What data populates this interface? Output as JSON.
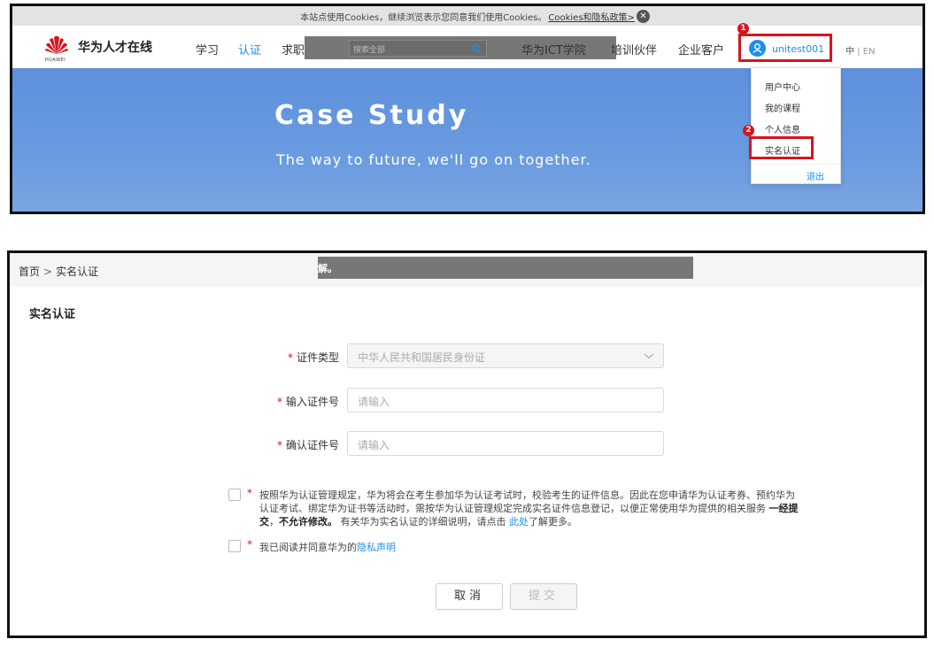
{
  "cookie": {
    "text": "本站点使用Cookies，继续浏览表示您同意我们使用Cookies。",
    "link": "Cookies和隐私政策>",
    "close": "✕"
  },
  "header": {
    "logo_small": "HUAWEI",
    "site_name": "华为人才在线",
    "nav": [
      "学习",
      "认证",
      "求职"
    ],
    "search_placeholder": "搜索全部",
    "nav_right": [
      "华为ICT学院",
      "培训伙伴",
      "企业客户"
    ],
    "user_name": "unitest001",
    "lang_zh": "中",
    "lang_sep": "|",
    "lang_en": "EN"
  },
  "banner": {
    "title": "Case Study",
    "subtitle": "The way to future, we'll go on together."
  },
  "user_menu": {
    "items": [
      "用户中心",
      "我的课程",
      "个人信息",
      "实名认证"
    ],
    "logout": "退出"
  },
  "steps": [
    "1",
    "2"
  ],
  "breadcrumb": {
    "home": "首页",
    "sep": ">",
    "current": "实名认证",
    "overlay_text": "解。"
  },
  "form": {
    "title": "实名认证",
    "required_mark": "*",
    "fields": [
      {
        "label": "证件类型",
        "value": "中华人民共和国居民身份证"
      },
      {
        "label": "输入证件号",
        "placeholder": "请输入"
      },
      {
        "label": "确认证件号",
        "placeholder": "请输入"
      }
    ],
    "agree_part1": "按照华为认证管理规定，华为将会在考生参加华为认证考试时，校验考生的证件信息。因此在您申请华为认证考券、预约华为认证考试、绑定华为证书等活动时，需按华为认证管理规定完成实名证件信息登记，以便正常使用华为提供的相关服务",
    "agree_bold1": "一经提交",
    "agree_comma": "，",
    "agree_bold2": "不允许修改。",
    "agree_part2": "有关华为实名认证的详细说明，请点击",
    "agree_link": "此处",
    "agree_part3": "了解更多。",
    "privacy_text": "我已阅读并同意华为的",
    "privacy_link": "隐私声明",
    "cancel": "取消",
    "submit": "提交"
  },
  "colors": {
    "accent": "#1b8ff0",
    "highlight": "#d6141c",
    "banner": "#6a9be0"
  }
}
